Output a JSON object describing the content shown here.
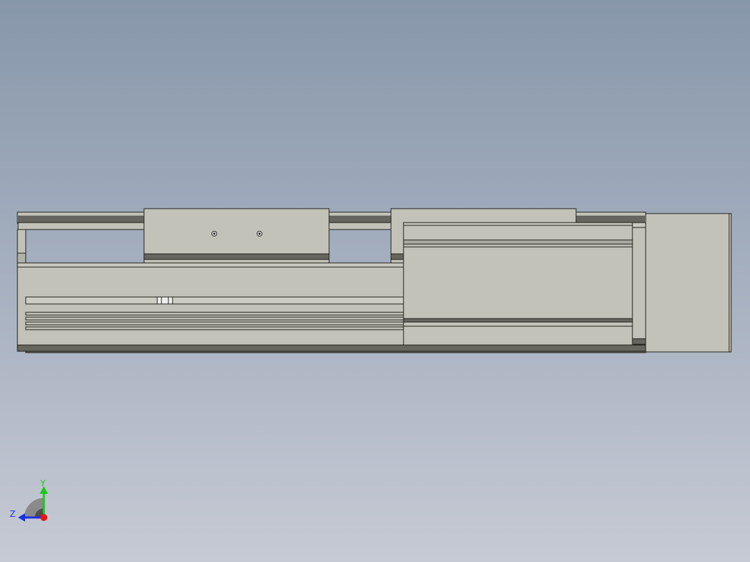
{
  "viewport": {
    "background_top": "#8797aa",
    "background_bottom": "#c6cad4"
  },
  "model": {
    "body_color": "#c2c2b8",
    "shadow_color": "#66665f",
    "edge_color": "#1e1e1a"
  },
  "triad": {
    "y_label": "Y",
    "z_label": "Z",
    "y_color": "#18c818",
    "z_color": "#1a2ee8",
    "x_color": "#e81414"
  }
}
